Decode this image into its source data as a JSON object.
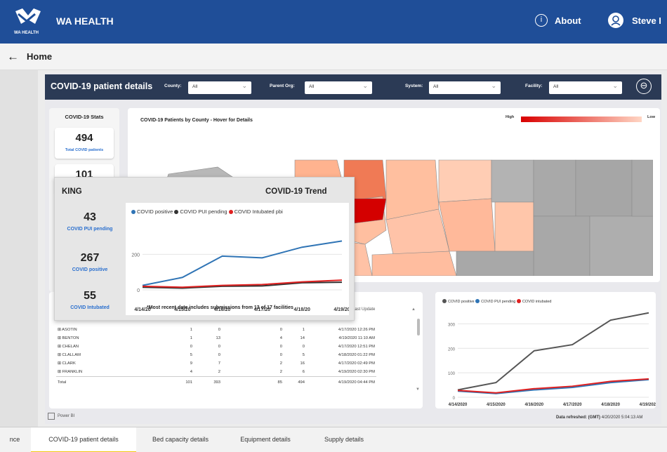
{
  "header": {
    "brand": "WA HEALTH",
    "logo_text": "WA HEALTH",
    "about_label": "About",
    "about_icon": "info-icon",
    "user_name": "Steve I",
    "colors": {
      "bar": "#1f4e98"
    }
  },
  "breadcrumb": {
    "back_icon": "←",
    "home_label": "Home"
  },
  "report": {
    "title": "COVID-19 patient details",
    "filters": [
      {
        "label": "County:",
        "value": "All"
      },
      {
        "label": "Parent Org:",
        "value": "All"
      },
      {
        "label": "System:",
        "value": "All"
      },
      {
        "label": "Facility:",
        "value": "All"
      }
    ],
    "back_icon": "⊖"
  },
  "stats": {
    "heading": "COVID-19 Stats",
    "cards": [
      {
        "value": "494",
        "label": "Total COVID patients"
      },
      {
        "value": "101",
        "label": ""
      }
    ]
  },
  "map": {
    "title": "COVID-19 Patients by County - Hover for Details",
    "legend_high": "High",
    "legend_low": "Low"
  },
  "table": {
    "last_update_header": "Last Update",
    "rows": [
      [
        "ASOTIN",
        "1",
        "0",
        "0",
        "1",
        "4/17/2020 12:26 PM"
      ],
      [
        "BENTON",
        "1",
        "13",
        "4",
        "14",
        "4/19/2020 11:10 AM"
      ],
      [
        "CHELAN",
        "0",
        "0",
        "0",
        "0",
        "4/17/2020 12:51 PM"
      ],
      [
        "CLALLAM",
        "5",
        "0",
        "0",
        "5",
        "4/18/2020 01:22 PM"
      ],
      [
        "CLARK",
        "9",
        "7",
        "2",
        "16",
        "4/17/2020 02:49 PM"
      ],
      [
        "FRANKLIN",
        "4",
        "2",
        "2",
        "6",
        "4/19/2020 02:30 PM"
      ]
    ],
    "total": [
      "Total",
      "101",
      "393",
      "85",
      "494",
      "4/19/2020 04:44 PM"
    ]
  },
  "trend_chart": {
    "legend": [
      "COVID positive",
      "COVID PUI pending",
      "COVID intubated"
    ]
  },
  "footer": {
    "powerbi": "Power BI",
    "refreshed_label": "Data refreshed: (GMT)",
    "refreshed_value": "4/20/2020 5:04:13 AM"
  },
  "tooltip": {
    "county": "KING",
    "title": "COVID-19 Trend",
    "stats": [
      {
        "value": "43",
        "label": "COVID PUI pending"
      },
      {
        "value": "267",
        "label": "COVID positive"
      },
      {
        "value": "55",
        "label": "COVID Intubated"
      }
    ],
    "legend": [
      "COVID positive",
      "COVID PUI pending",
      "COVID Intubated pbi"
    ],
    "note": "*Most recent date includes submissions from 13 of 17 facilities"
  },
  "tabs": [
    {
      "label": "nce",
      "active": false
    },
    {
      "label": "COVID-19 patient details",
      "active": true
    },
    {
      "label": "Bed capacity details",
      "active": false
    },
    {
      "label": "Equipment details",
      "active": false
    },
    {
      "label": "Supply details",
      "active": false
    }
  ],
  "chart_data": [
    {
      "type": "line",
      "title": "COVID-19 Trend",
      "x": [
        "4/14/20",
        "4/15/20",
        "4/16/20",
        "4/17/20",
        "4/18/20",
        "4/19/20"
      ],
      "ylim": [
        0,
        300
      ],
      "yticks": [
        0,
        200
      ],
      "series": [
        {
          "name": "COVID positive",
          "color": "#2f74b5",
          "values": [
            25,
            70,
            190,
            180,
            240,
            275
          ]
        },
        {
          "name": "COVID PUI pending",
          "color": "#333333",
          "values": [
            15,
            10,
            20,
            22,
            40,
            43
          ]
        },
        {
          "name": "COVID Intubated pbi",
          "color": "#e02020",
          "values": [
            20,
            15,
            25,
            30,
            45,
            55
          ]
        }
      ]
    },
    {
      "type": "line",
      "x": [
        "4/14/2020",
        "4/15/2020",
        "4/16/2020",
        "4/17/2020",
        "4/18/2020",
        "4/19/2020"
      ],
      "ylim": [
        0,
        350
      ],
      "yticks": [
        0,
        100,
        200,
        300
      ],
      "series": [
        {
          "name": "COVID positive",
          "color": "#555555",
          "values": [
            30,
            60,
            190,
            215,
            315,
            345
          ]
        },
        {
          "name": "COVID PUI pending",
          "color": "#2f74b5",
          "values": [
            25,
            15,
            30,
            40,
            60,
            72
          ]
        },
        {
          "name": "COVID intubated",
          "color": "#e02020",
          "values": [
            28,
            18,
            35,
            45,
            65,
            75
          ]
        }
      ]
    }
  ]
}
